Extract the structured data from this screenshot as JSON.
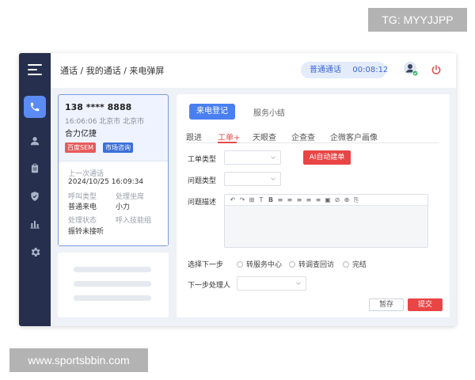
{
  "watermarks": {
    "telegram": "TG: MYYJJPP",
    "site": "www.sportsbbin.com"
  },
  "sidebar": {
    "items": [
      {
        "icon": "phone-icon",
        "active": true
      },
      {
        "icon": "user-icon",
        "active": false
      },
      {
        "icon": "clipboard-icon",
        "active": false
      },
      {
        "icon": "shield-icon",
        "active": false
      },
      {
        "icon": "bar-chart-icon",
        "active": false
      },
      {
        "icon": "gear-icon",
        "active": false
      }
    ]
  },
  "topbar": {
    "breadcrumb": "通话 / 我的通话 / 来电弹屏",
    "call_type": "普通通话",
    "call_timer": "00:08:12"
  },
  "caller": {
    "phone": "138 **** 8888",
    "time_location": "16:06:06  北京市 北京市",
    "company": "合力亿捷",
    "tags": [
      "百度SEM",
      "市场咨询"
    ],
    "last_call_label": "上一次通话",
    "last_call_time": "2024/10/25  16:09:34",
    "call_type_label": "呼叫类型",
    "call_type_value": "普通来电",
    "handler_label": "处理坐席",
    "handler_value": "小力",
    "status_label": "处理状态",
    "status_value": "振铃未接听",
    "skill_group_label": "呼入技能组"
  },
  "main": {
    "tabs": [
      "来电登记",
      "服务小结"
    ],
    "subtabs": [
      "跟进",
      "工单+",
      "天眼查",
      "企查查",
      "企微客户画像"
    ],
    "form": {
      "ticket_type_label": "工单类型",
      "problem_type_label": "问题类型",
      "problem_desc_label": "问题描述",
      "ai_button": "AI自动建单",
      "next_step_label": "选择下一步",
      "next_step_options": [
        "转服务中心",
        "转调查回访",
        "完结"
      ],
      "next_handler_label": "下一步处理人"
    },
    "editor_tools": [
      "↶",
      "↷",
      "⊞",
      "T",
      "B",
      "≡",
      "≡",
      "≡",
      "≡",
      "≡",
      "▣",
      "⊘",
      "⊕",
      "⎘"
    ],
    "save_label": "暂存",
    "submit_label": "提交"
  },
  "colors": {
    "sidebar": "#262f4d",
    "primary": "#4a7ff0",
    "danger": "#e94545"
  }
}
